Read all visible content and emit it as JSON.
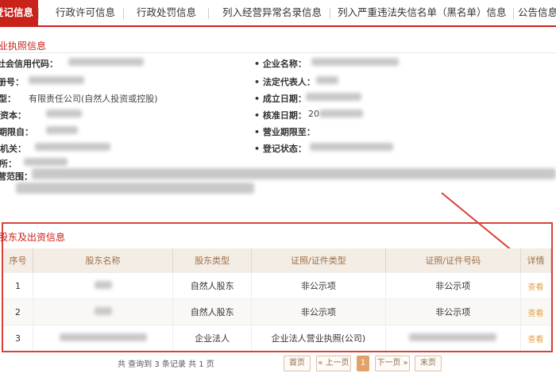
{
  "tabs": [
    {
      "label": "登记信息",
      "active": true
    },
    {
      "label": "行政许可信息"
    },
    {
      "label": "行政处罚信息"
    },
    {
      "label": "列入经营异常名录信息"
    },
    {
      "label": "列入严重违法失信名单（黑名单）信息"
    },
    {
      "label": "公告信息"
    }
  ],
  "license": {
    "title": "营业执照信息",
    "fields": [
      {
        "label": "统一社会信用代码：",
        "value": ""
      },
      {
        "label": "企业名称：",
        "value": ""
      },
      {
        "label": "注册号：",
        "value": ""
      },
      {
        "label": "法定代表人：",
        "value": ""
      },
      {
        "label": "类型：",
        "value": "有限责任公司(自然人投资或控股)"
      },
      {
        "label": "成立日期：",
        "value": ""
      },
      {
        "label": "注册资本：",
        "value": ""
      },
      {
        "label": "核准日期：",
        "value": "20"
      },
      {
        "label": "营业期限自：",
        "value": ""
      },
      {
        "label": "营业期限至：",
        "value": ""
      },
      {
        "label": "登记机关：",
        "value": ""
      },
      {
        "label": "登记状态：",
        "value": ""
      },
      {
        "label": "住所：",
        "value": ""
      },
      {
        "label": "经营范围：",
        "value": ""
      }
    ]
  },
  "shareholders": {
    "title": "股东及出资信息",
    "columns": [
      "序号",
      "股东名称",
      "股东类型",
      "证照/证件类型",
      "证照/证件号码",
      "详情"
    ],
    "rows": [
      {
        "no": "1",
        "name": "",
        "type": "自然人股东",
        "cert_type": "非公示项",
        "cert_no": "非公示项",
        "detail": "查看"
      },
      {
        "no": "2",
        "name": "",
        "type": "自然人股东",
        "cert_type": "非公示项",
        "cert_no": "非公示项",
        "detail": "查看"
      },
      {
        "no": "3",
        "name": "",
        "type": "企业法人",
        "cert_type": "企业法人营业执照(公司)",
        "cert_no": "",
        "detail": "查看"
      }
    ]
  },
  "pager": {
    "summary": "共 查询到 3 条记录 共 1 页",
    "first": "首页",
    "prev": "« 上一页",
    "current": "1",
    "next": "下一页 »",
    "last": "末页"
  },
  "colors": {
    "accent": "#c9221b",
    "header_bg": "#f3ede6",
    "header_text": "#a17046",
    "annotation": "#d9423a"
  }
}
